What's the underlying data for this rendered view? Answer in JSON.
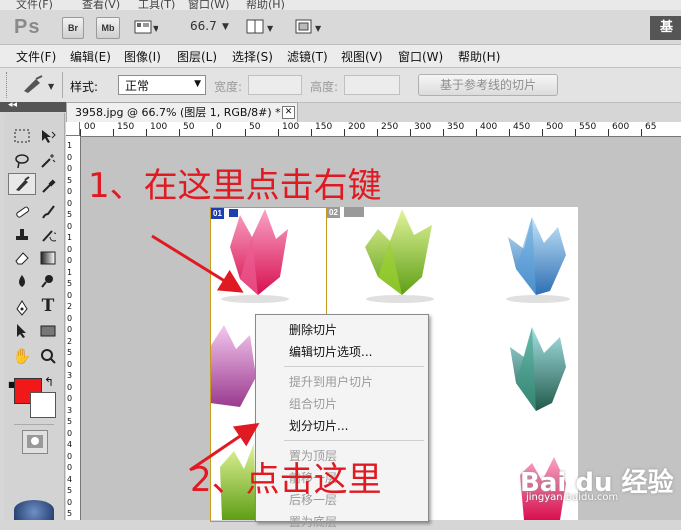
{
  "top_strip": [
    "文件(F)",
    "查看(V)",
    "工具(T)",
    "窗口(W)",
    "帮助(H)"
  ],
  "app_bar": {
    "logo": "Ps",
    "bridge_btn": "Br",
    "minibridge_btn": "Mb",
    "zoom_value": "66.7",
    "workspace_label": "基"
  },
  "menu_bar": [
    "文件(F)",
    "编辑(E)",
    "图像(I)",
    "图层(L)",
    "选择(S)",
    "滤镜(T)",
    "视图(V)",
    "窗口(W)",
    "帮助(H)"
  ],
  "options_bar": {
    "style_label": "样式:",
    "style_value": "正常",
    "width_label": "宽度:",
    "height_label": "高度:",
    "guides_button": "基于参考线的切片"
  },
  "document": {
    "tab_title": "3958.jpg @ 66.7% (图层 1, RGB/8#) *",
    "close_symbol": "✕",
    "slice_badges": [
      "01",
      "02"
    ]
  },
  "rulers": {
    "horizontal": [
      "00",
      "150",
      "100",
      "50",
      "0",
      "50",
      "100",
      "150",
      "200",
      "250",
      "300",
      "350",
      "400",
      "450",
      "500",
      "550",
      "600",
      "65"
    ],
    "vertical": [
      "1",
      "0",
      "0",
      "5",
      "0",
      "0",
      "5",
      "0",
      "1",
      "0",
      "0",
      "1",
      "5",
      "0",
      "2",
      "0",
      "0",
      "2",
      "5",
      "0",
      "3",
      "0",
      "0",
      "3",
      "5",
      "0",
      "4",
      "0",
      "0",
      "4",
      "5",
      "0",
      "5"
    ]
  },
  "context_menu": {
    "items": [
      {
        "label": "删除切片",
        "enabled": true
      },
      {
        "label": "编辑切片选项...",
        "enabled": true
      },
      {
        "label": "提升到用户切片",
        "enabled": false
      },
      {
        "label": "组合切片",
        "enabled": false
      },
      {
        "label": "划分切片...",
        "enabled": true,
        "highlighted": true
      },
      {
        "label": "置为顶层",
        "enabled": false
      },
      {
        "label": "前移一层",
        "enabled": false
      },
      {
        "label": "后移一层",
        "enabled": false
      },
      {
        "label": "置为底层",
        "enabled": false
      }
    ]
  },
  "annotations": {
    "step1": "1、在这里点击右键",
    "step2": "2、点击这里",
    "color": "#e01a22"
  },
  "watermark": {
    "brand": "Bai du 经验",
    "url": "jingyan.baidu.com"
  },
  "colors": {
    "foreground": "#f01818",
    "background": "#ffffff",
    "highlight_border": "#e0121c"
  }
}
